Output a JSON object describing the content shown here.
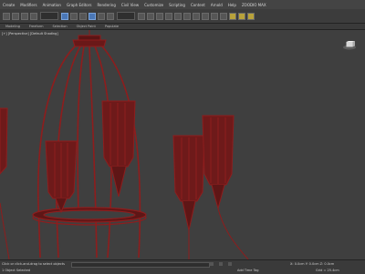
{
  "menu": [
    "Create",
    "Modifiers",
    "Animation",
    "Graph Editors",
    "Rendering",
    "Civil View",
    "Customize",
    "Scripting",
    "Content",
    "Arnold",
    "Help",
    "ZOODIO MAX"
  ],
  "toolbar": {
    "selection_filter": "All",
    "reference_dropdown": "View"
  },
  "ribbon": [
    "Modeling",
    "Freeform",
    "Selection",
    "Object Paint",
    "Populate"
  ],
  "viewport": {
    "label": "[+] [Perspective] [Default Shading]"
  },
  "status": {
    "prompt": "Click or click-and-drag to select objects",
    "selection": "1 Object Selected",
    "coords": "X: 0.0cm  Y: 0.0cm  Z: 0.0cm",
    "grid": "Grid = 25.4cm",
    "time_tag": "Add Time Tag"
  },
  "colors": {
    "mesh": "#8e1d1d",
    "viewport_bg": "#3f3f3f",
    "active_tool": "#4a77b6"
  }
}
